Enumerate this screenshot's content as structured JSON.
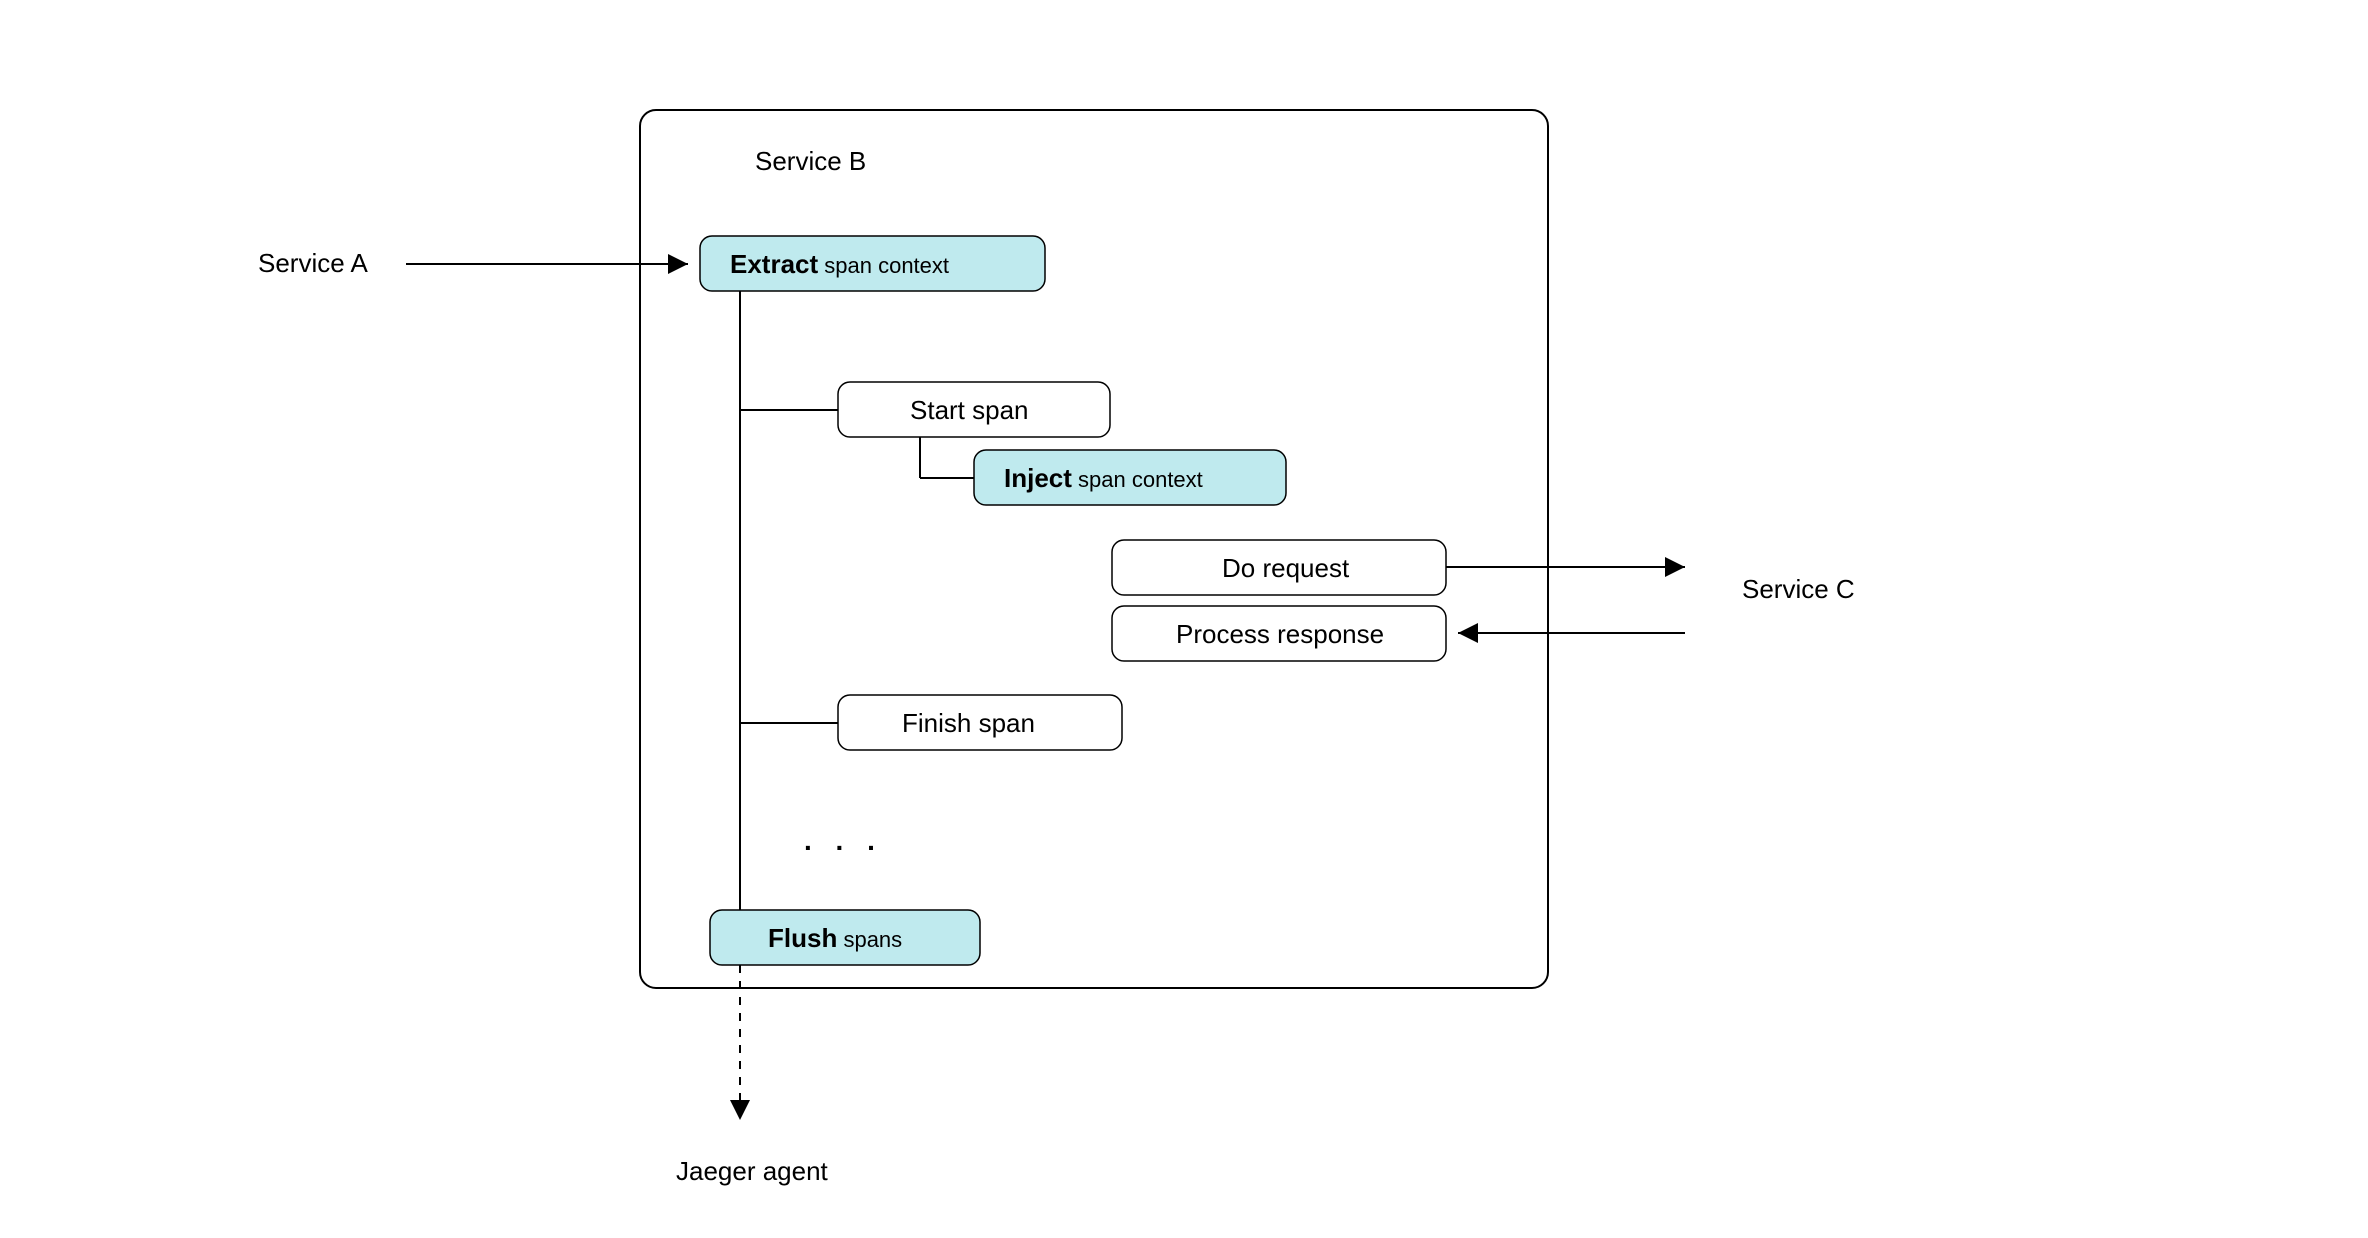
{
  "external": {
    "serviceA": "Service A",
    "serviceC": "Service C",
    "jaegerAgent": "Jaeger agent"
  },
  "container": {
    "title": "Service B"
  },
  "nodes": {
    "extract": {
      "bold": "Extract",
      "rest": " span context"
    },
    "startSpan": "Start span",
    "inject": {
      "bold": "Inject",
      "rest": " span context"
    },
    "doRequest": "Do request",
    "processResponse": "Process response",
    "finishSpan": "Finish span",
    "ellipsis": ". . .",
    "flush": {
      "bold": "Flush",
      "rest": " spans"
    }
  }
}
